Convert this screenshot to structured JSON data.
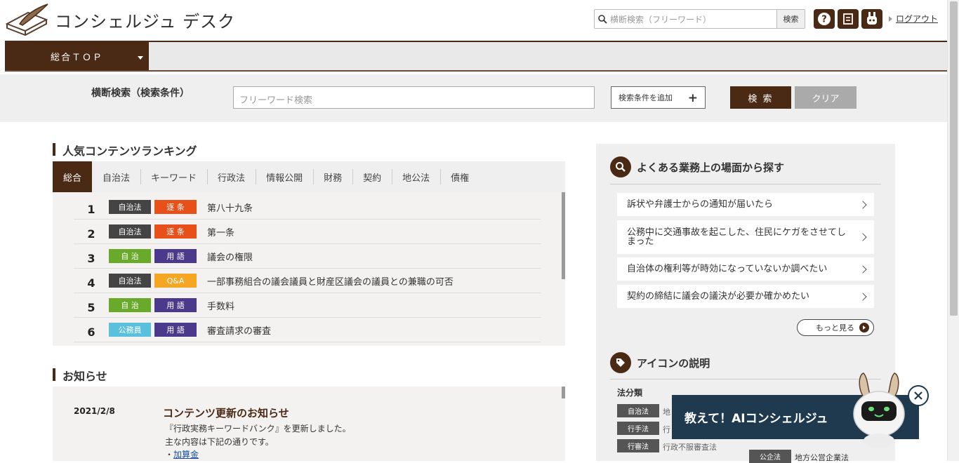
{
  "header": {
    "logo_text": "コンシェルジュ デスク",
    "search_placeholder": "横断検索（フリーワード）",
    "search_button": "検索",
    "icons": [
      "help-icon",
      "document-icon",
      "robot-icon"
    ],
    "logout": "ログアウト"
  },
  "nav": {
    "top_label": "総合ＴＯＰ"
  },
  "search_panel": {
    "label": "横断検索（検索条件）",
    "input_placeholder": "フリーワード検索",
    "add_condition": "検索条件を追加",
    "add_symbol": "+",
    "search_button": "検 索",
    "clear_button": "クリア"
  },
  "ranking": {
    "title": "人気コンテンツランキング",
    "tabs": [
      "総合",
      "自治法",
      "キーワード",
      "行政法",
      "情報公開",
      "財務",
      "契約",
      "地公法",
      "債権"
    ],
    "active_tab": "総合",
    "rows": [
      {
        "rank": "1",
        "cat": "自治法",
        "cat_color": "#444444",
        "type": "逐 条",
        "type_color": "#e8501a",
        "title": "第八十九条"
      },
      {
        "rank": "2",
        "cat": "自治法",
        "cat_color": "#444444",
        "type": "逐 条",
        "type_color": "#e8501a",
        "title": "第一条"
      },
      {
        "rank": "3",
        "cat": "自 治",
        "cat_color": "#6aaa2a",
        "type": "用 語",
        "type_color": "#4b3a8c",
        "title": "議会の権限"
      },
      {
        "rank": "4",
        "cat": "自治法",
        "cat_color": "#444444",
        "type": "Q&A",
        "type_color": "#f5a623",
        "title": "一部事務組合の議会議員と財産区議会の議員との兼職の可否"
      },
      {
        "rank": "5",
        "cat": "自 治",
        "cat_color": "#6aaa2a",
        "type": "用 語",
        "type_color": "#4b3a8c",
        "title": "手数料"
      },
      {
        "rank": "6",
        "cat": "公務員",
        "cat_color": "#5bc0de",
        "type": "用 語",
        "type_color": "#4b3a8c",
        "title": "審査請求の審査"
      }
    ]
  },
  "news": {
    "title": "お知らせ",
    "items": [
      {
        "date": "2021/2/8",
        "heading": "コンテンツ更新のお知らせ",
        "line1": "『行政実務キーワードバンク』を更新しました。",
        "line2": "主な内容は下記の通りです。",
        "bullet": "・",
        "link": "加算金"
      }
    ]
  },
  "scenes": {
    "title": "よくある業務上の場面から探す",
    "items": [
      "訴状や弁護士からの通知が届いたら",
      "公務中に交通事故を起こした、住民にケガをさせてしまった",
      "自治体の権利等が時効になっていないか調べたい",
      "契約の締結に議会の議決が必要か確かめたい"
    ],
    "more": "もっと見る"
  },
  "icon_legend": {
    "title": "アイコンの説明",
    "category_title": "法分類",
    "tags": [
      {
        "tag": "自治法",
        "text": "地"
      },
      {
        "tag": "行手法",
        "text": "行"
      },
      {
        "tag": "行審法",
        "text": "行政不服審査法"
      }
    ],
    "extra_tag": "公企法",
    "extra_text": "地方公営企業法"
  },
  "ai": {
    "label": "教えて！AIコンシェルジュ"
  },
  "colors": {
    "brand": "#4a2a14",
    "ai_bg": "#1f3a4f",
    "panel_bg": "#efefef"
  }
}
